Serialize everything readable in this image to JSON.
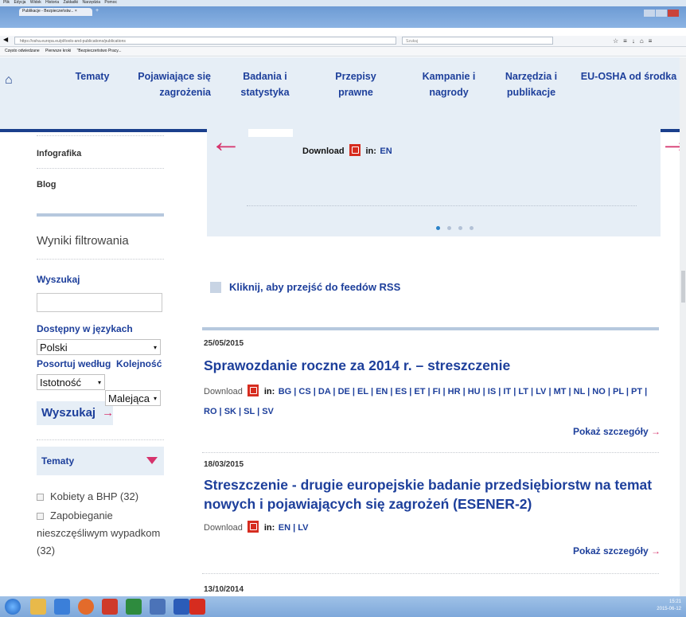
{
  "browser": {
    "menu": [
      "Plik",
      "Edycja",
      "Widok",
      "Historia",
      "Zakładki",
      "Narzędzia",
      "Pomoc"
    ],
    "tab_title": "Publikacje - Bezpieczeństw...",
    "url": "https://osha.europa.eu/pl/tools-and-publications/publications",
    "search_placeholder": "Szukaj",
    "bookmarks": [
      "Często odwiedzane",
      "Pierwsze kroki",
      "\"Bezpieczeństwo Pracy..."
    ]
  },
  "site_nav": {
    "items": [
      "Tematy",
      "Pojawiające się zagrożenia",
      "Badania i statystyka",
      "Przepisy prawne",
      "Kampanie i nagrody",
      "Narzędzia i publikacje",
      "EU-OSHA od środka"
    ]
  },
  "sidebar": {
    "infografika": "Infografika",
    "blog": "Blog",
    "filter_heading": "Wyniki filtrowania",
    "search_label": "Wyszukaj",
    "languages_label": "Dostępny w językach",
    "language_value": "Polski",
    "sort_label": "Posortuj według",
    "order_label": "Kolejność",
    "sort_value": "Istotność",
    "order_value": "Malejąca",
    "search_button": "Wyszukaj",
    "search_button_arrow": "→",
    "topics_heading": "Tematy",
    "topics": [
      {
        "label": "Kobiety a BHP (32)"
      },
      {
        "label": "Zapobieganie nieszczęśliwym wypadkom (32)"
      }
    ]
  },
  "carousel": {
    "download_label": "Download",
    "in_label": "in:",
    "lang": "EN",
    "prev": "←",
    "next": "→"
  },
  "rss": {
    "label": "Kliknij, aby przejść do feedów RSS"
  },
  "publications": [
    {
      "date": "25/05/2015",
      "title": "Sprawozdanie roczne za 2014 r. – streszczenie",
      "download": "Download",
      "in": "in:",
      "languages": "BG | CS | DA | DE | EL | EN | ES | ET | FI | HR | HU | IS | IT | LT | LV | MT | NL | NO | PL | PT | RO | SK | SL | SV",
      "more": "Pokaż szczegóły",
      "arrow": "→"
    },
    {
      "date": "18/03/2015",
      "title": "Streszczenie - drugie europejskie badanie przedsiębiorstw na temat nowych i pojawiających się zagrożeń (ESENER-2)",
      "download": "Download",
      "in": "in:",
      "languages": "EN | LV",
      "more": "Pokaż szczegóły",
      "arrow": "→"
    },
    {
      "date": "13/10/2014"
    }
  ],
  "taskbar": {
    "time": "15:21",
    "date": "2015-06-12"
  },
  "colors": {
    "brand_blue": "#1d3f9b",
    "accent_pink": "#d6336c",
    "panel_bg": "#e6eef6"
  }
}
